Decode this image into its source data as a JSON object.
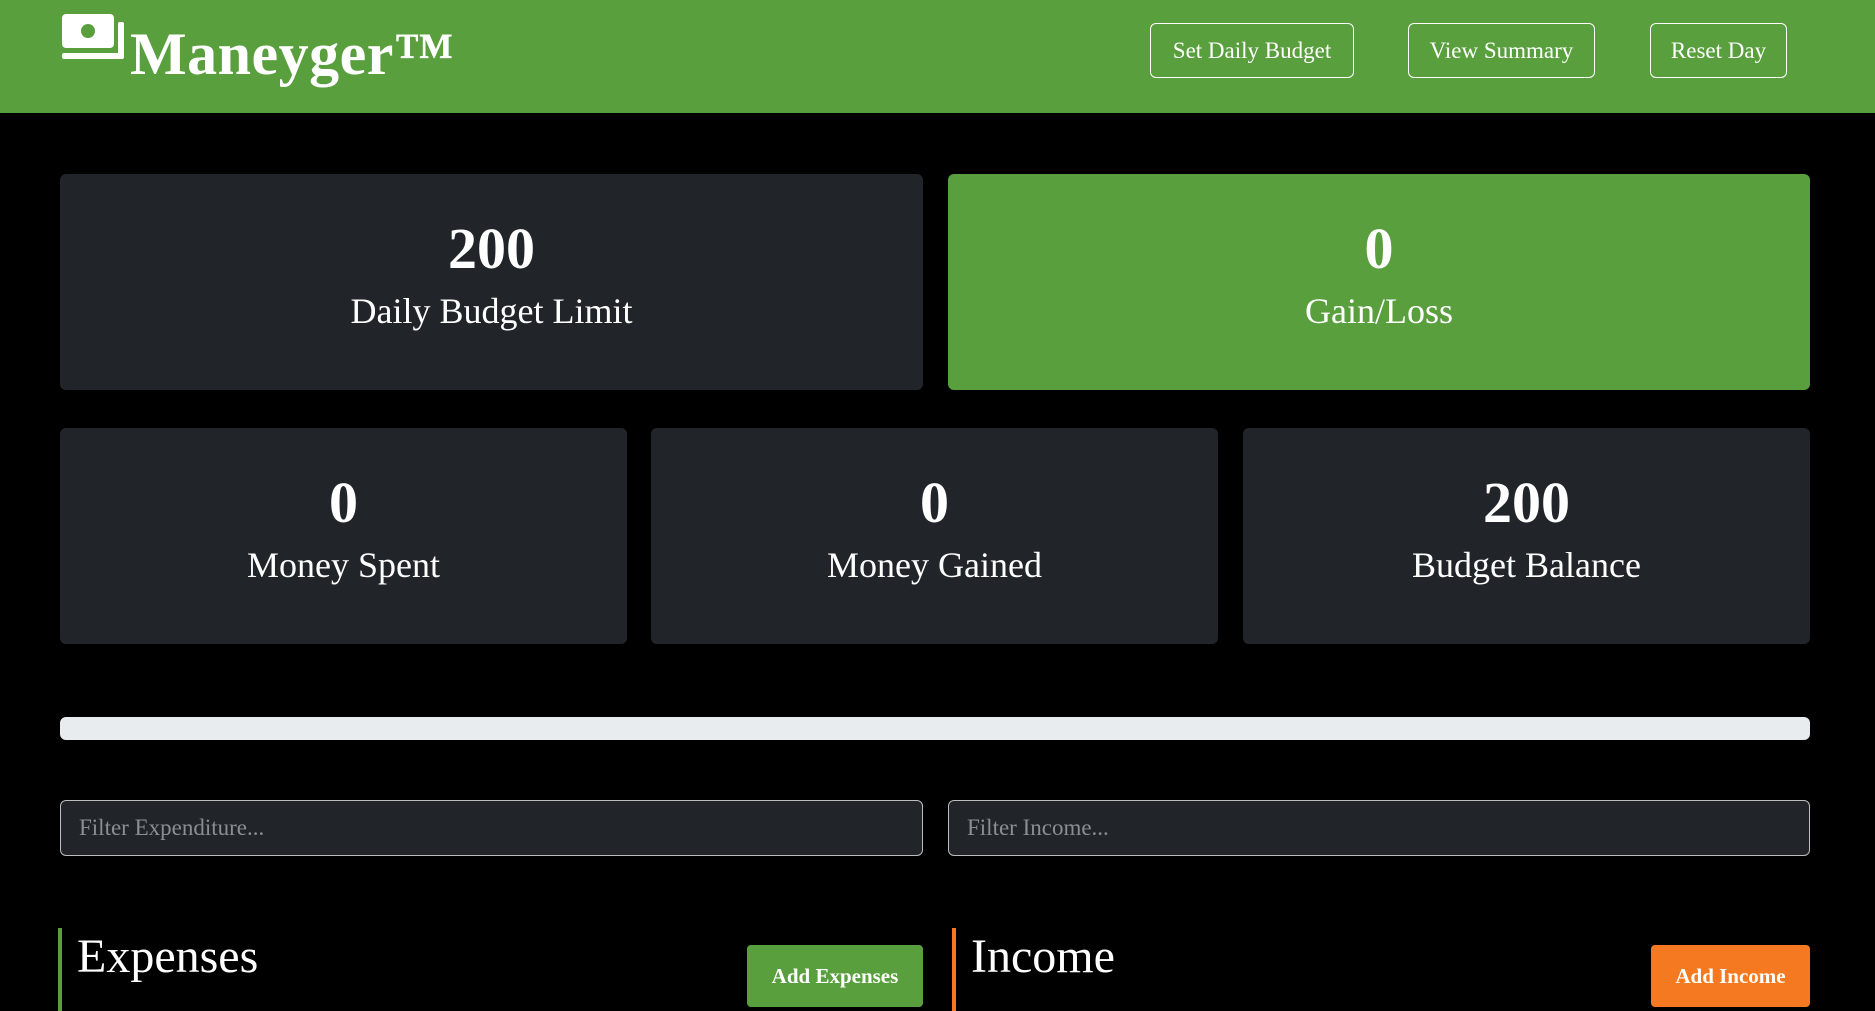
{
  "brand": {
    "name": "Maneyger™",
    "icon": "money-bill-icon"
  },
  "nav": {
    "set_budget": "Set Daily Budget",
    "view_summary": "View Summary",
    "reset_day": "Reset Day"
  },
  "stats": {
    "daily_budget": {
      "value": "200",
      "label": "Daily Budget Limit"
    },
    "gain_loss": {
      "value": "0",
      "label": "Gain/Loss"
    },
    "money_spent": {
      "value": "0",
      "label": "Money Spent"
    },
    "money_gained": {
      "value": "0",
      "label": "Money Gained"
    },
    "budget_balance": {
      "value": "200",
      "label": "Budget Balance"
    }
  },
  "progress": {
    "spent_fraction": 0
  },
  "filters": {
    "expenditure_placeholder": "Filter Expenditure...",
    "income_placeholder": "Filter Income..."
  },
  "sections": {
    "expenses": {
      "title": "Expenses",
      "add_label": "Add Expenses"
    },
    "income": {
      "title": "Income",
      "add_label": "Add Income"
    }
  },
  "colors": {
    "primary_green": "#5a9f3e",
    "accent_orange": "#f47920",
    "card_dark": "#212529",
    "background": "#000000"
  }
}
